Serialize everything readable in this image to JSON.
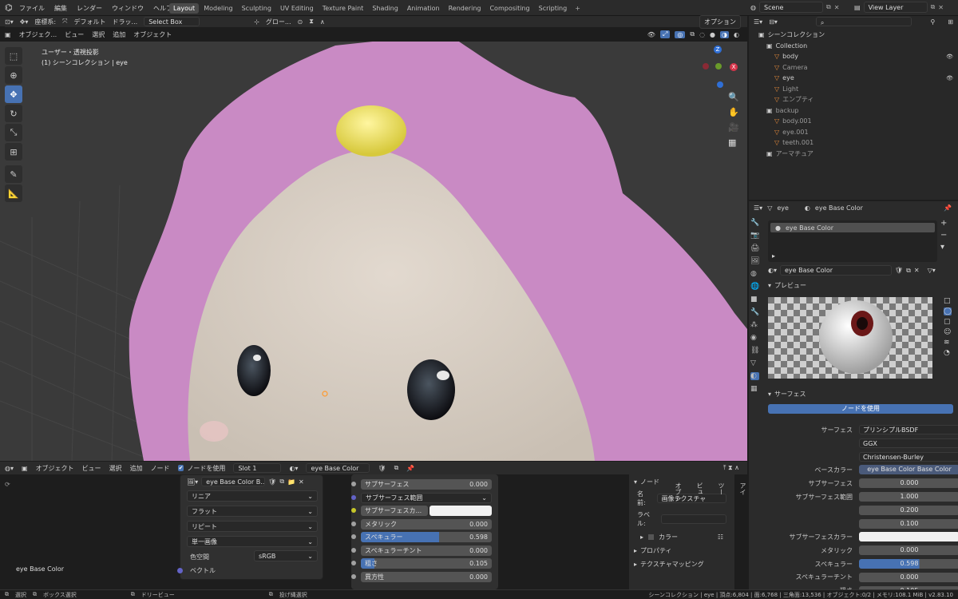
{
  "topbar": {
    "menus": [
      "ファイル",
      "編集",
      "レンダー",
      "ウィンドウ",
      "ヘルプ"
    ],
    "tabs": [
      "Layout",
      "Modeling",
      "Sculpting",
      "UV Editing",
      "Texture Paint",
      "Shading",
      "Animation",
      "Rendering",
      "Compositing",
      "Scripting"
    ],
    "active_tab": "Layout",
    "scene": "Scene",
    "view_layer": "View Layer"
  },
  "viewport_header": {
    "coord_label": "座標系:",
    "coord_value": "デフォルト",
    "drag_label": "ドラッ...",
    "drag_value": "Select Box",
    "global": "グロー...",
    "options": "オプション",
    "mode": "オブジェク...",
    "menus": [
      "ビュー",
      "選択",
      "追加",
      "オブジェクト"
    ]
  },
  "viewport": {
    "overlay_line1": "ユーザー・透視投影",
    "overlay_line2": "(1) シーンコレクション | eye",
    "gizmo_x": "X",
    "gizmo_z": "Z"
  },
  "outliner": {
    "root": "シーンコレクション",
    "items": [
      {
        "name": "Collection",
        "indent": 1,
        "dim": false
      },
      {
        "name": "body",
        "indent": 2,
        "dim": false
      },
      {
        "name": "Camera",
        "indent": 2,
        "dim": true
      },
      {
        "name": "eye",
        "indent": 2,
        "dim": false
      },
      {
        "name": "Light",
        "indent": 2,
        "dim": true
      },
      {
        "name": "エンプティ",
        "indent": 2,
        "dim": true
      },
      {
        "name": "backup",
        "indent": 1,
        "dim": true
      },
      {
        "name": "body.001",
        "indent": 2,
        "dim": true
      },
      {
        "name": "eye.001",
        "indent": 2,
        "dim": true
      },
      {
        "name": "teeth.001",
        "indent": 2,
        "dim": true
      },
      {
        "name": "アーマチュア",
        "indent": 1,
        "dim": true
      }
    ]
  },
  "props": {
    "breadcrumb_object": "eye",
    "breadcrumb_material": "eye Base Color",
    "slot_name": "eye Base Color",
    "material_name": "eye Base Color",
    "preview_label": "プレビュー",
    "surface_label": "サーフェス",
    "use_nodes": "ノードを使用",
    "rows": [
      {
        "label": "サーフェス",
        "value": "プリンシプルBSDF",
        "type": "text"
      },
      {
        "label": "",
        "value": "GGX",
        "type": "dd"
      },
      {
        "label": "",
        "value": "Christensen-Burley",
        "type": "dd"
      },
      {
        "label": "ベースカラー",
        "value": "eye Base Color Base Color",
        "type": "link"
      },
      {
        "label": "サブサーフェス",
        "value": "0.000",
        "type": "num"
      },
      {
        "label": "サブサーフェス範囲",
        "value": "1.000",
        "type": "num"
      },
      {
        "label": "",
        "value": "0.200",
        "type": "num"
      },
      {
        "label": "",
        "value": "0.100",
        "type": "num"
      },
      {
        "label": "サブサーフェスカラー",
        "value": "",
        "type": "color"
      },
      {
        "label": "メタリック",
        "value": "0.000",
        "type": "num"
      },
      {
        "label": "スペキュラー",
        "value": "0.598",
        "type": "bar"
      },
      {
        "label": "スペキュラーチント",
        "value": "0.000",
        "type": "num"
      },
      {
        "label": "粗さ",
        "value": "0.105",
        "type": "num"
      }
    ]
  },
  "node_header": {
    "mode": "オブジェクト",
    "menus": [
      "ビュー",
      "選択",
      "追加",
      "ノード"
    ],
    "use_nodes": "ノードを使用",
    "slot": "Slot 1",
    "material": "eye Base Color"
  },
  "image_node": {
    "image_name": "eye Base Color B...",
    "interp": "リニア",
    "proj": "フラット",
    "ext": "リピート",
    "source": "単一画像",
    "colorspace_label": "色空間",
    "colorspace": "sRGB",
    "vector": "ベクトル",
    "frame_label": "eye Base Color"
  },
  "bsdf_node": {
    "rows": [
      {
        "label": "サブサーフェス",
        "value": "0.000",
        "socket": "#a1a1a1"
      },
      {
        "label": "サブサーフェス範囲",
        "value": "",
        "socket": "#6363c7",
        "dd": true
      },
      {
        "label": "サブサーフェスカ...",
        "value": "",
        "socket": "#c7c729",
        "color": true
      },
      {
        "label": "メタリック",
        "value": "0.000",
        "socket": "#a1a1a1"
      },
      {
        "label": "スペキュラー",
        "value": "0.598",
        "socket": "#a1a1a1",
        "fill": 0.598
      },
      {
        "label": "スペキュラーチント",
        "value": "0.000",
        "socket": "#a1a1a1"
      },
      {
        "label": "粗さ",
        "value": "0.105",
        "socket": "#a1a1a1",
        "fill": 0.105
      },
      {
        "label": "異方性",
        "value": "0.000",
        "socket": "#a1a1a1"
      }
    ]
  },
  "node_sidebar": {
    "title": "ノード",
    "name_label": "名前:",
    "name_value": "画像テクスチャ",
    "label_label": "ラベル:",
    "color": "カラー",
    "properties": "プロパティ",
    "tex_mapping": "テクスチャマッピング",
    "tabs": [
      "アイ",
      "ツー",
      "ビュ",
      "オプシ"
    ]
  },
  "status": {
    "select": "選択",
    "box_select": "ボックス選択",
    "dolly": "ドリービュー",
    "lasso": "投げ縄選択",
    "stats": "シーンコレクション | eye | 頂点:6,804 | 面:6,768 | 三角面:13,536 | オブジェクト:0/2 | メモリ:108.1 MiB | v2.83.10"
  },
  "colors": {
    "accent": "#4772b3",
    "bg": "#1d1d1d",
    "panel": "#2b2b2b",
    "hair": "#c98ac4",
    "skin": "#d8cfc5"
  }
}
